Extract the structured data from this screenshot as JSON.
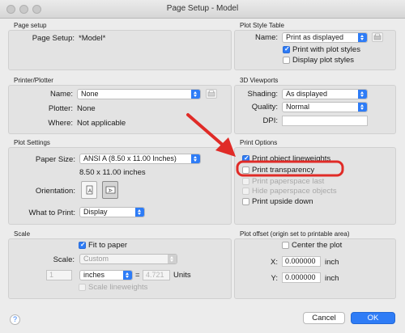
{
  "window": {
    "title": "Page Setup - Model"
  },
  "page_setup": {
    "section": "Page setup",
    "label": "Page Setup:",
    "value": "*Model*"
  },
  "plot_style": {
    "section": "Plot Style Table",
    "name_label": "Name:",
    "name_value": "Print as displayed",
    "print_styles": "Print with plot styles",
    "display_styles": "Display plot styles"
  },
  "printer": {
    "section": "Printer/Plotter",
    "name_label": "Name:",
    "name_value": "None",
    "plotter_label": "Plotter:",
    "plotter_value": "None",
    "where_label": "Where:",
    "where_value": "Not applicable"
  },
  "viewports": {
    "section": "3D Viewports",
    "shading_label": "Shading:",
    "shading_value": "As displayed",
    "quality_label": "Quality:",
    "quality_value": "Normal",
    "dpi_label": "DPI:"
  },
  "plot_settings": {
    "section": "Plot Settings",
    "paper_label": "Paper Size:",
    "paper_value": "ANSI A (8.50 x 11.00 Inches)",
    "paper_dims": "8.50 x 11.00 inches",
    "orientation_label": "Orientation:",
    "what_label": "What to Print:",
    "what_value": "Display"
  },
  "print_options": {
    "section": "Print Options",
    "lineweights": "Print object lineweights",
    "transparency": "Print transparency",
    "paperspace_last": "Print paperspace last",
    "hide_paperspace": "Hide paperspace objects",
    "upside_down": "Print upside down"
  },
  "scale": {
    "section": "Scale",
    "fit": "Fit to paper",
    "scale_label": "Scale:",
    "scale_value": "Custom",
    "left_value": "1",
    "unit_value": "inches",
    "equals": "=",
    "right_value": "4.721",
    "units_label": "Units",
    "lineweights": "Scale lineweights"
  },
  "offset": {
    "section": "Plot offset (origin set to printable area)",
    "center": "Center the plot",
    "x_label": "X:",
    "x_value": "0.000000",
    "y_label": "Y:",
    "y_value": "0.000000",
    "unit": "inch"
  },
  "footer": {
    "help": "?",
    "cancel": "Cancel",
    "ok": "OK"
  },
  "colors": {
    "accent": "#2e7cf6",
    "annotation": "#e02b27"
  }
}
